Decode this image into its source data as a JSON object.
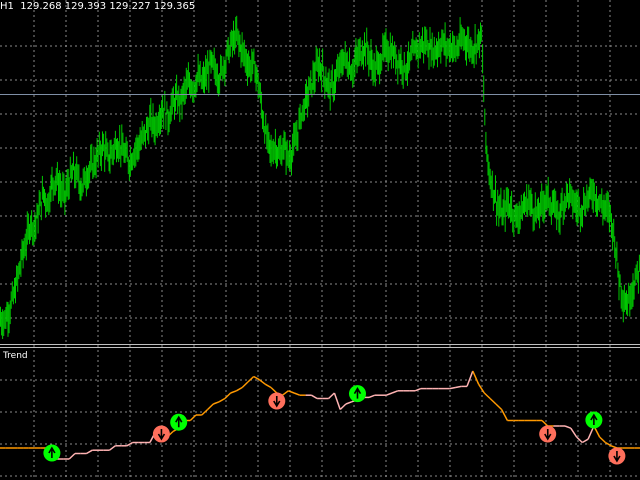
{
  "header": {
    "timeframe": "H1",
    "ohlc": "129.268 129.393 129.227 129.365"
  },
  "indicator": {
    "label": "Trend"
  },
  "colors": {
    "background": "#000000",
    "candle": "#00c800",
    "grid": "#8a8a8a",
    "price_line": "#7f8fa6",
    "separator": "#bfbfbf",
    "trend_up": "#ffb3b3",
    "trend_down": "#ff9900",
    "buy_arrow": "#00ff00",
    "sell_arrow": "#ff6f5c"
  },
  "chart_data": [
    {
      "type": "candlestick",
      "price_series_close": [
        0.05,
        0.08,
        0.12,
        0.18,
        0.25,
        0.3,
        0.36,
        0.34,
        0.4,
        0.45,
        0.42,
        0.48,
        0.5,
        0.46,
        0.44,
        0.49,
        0.52,
        0.5,
        0.47,
        0.51,
        0.53,
        0.55,
        0.58,
        0.6,
        0.56,
        0.58,
        0.61,
        0.6,
        0.57,
        0.55,
        0.58,
        0.6,
        0.62,
        0.65,
        0.68,
        0.66,
        0.7,
        0.72,
        0.69,
        0.73,
        0.75,
        0.74,
        0.78,
        0.8,
        0.79,
        0.82,
        0.8,
        0.83,
        0.86,
        0.84,
        0.82,
        0.86,
        0.9,
        0.93,
        0.95,
        0.91,
        0.88,
        0.85,
        0.86,
        0.8,
        0.7,
        0.62,
        0.58,
        0.6,
        0.57,
        0.6,
        0.56,
        0.59,
        0.63,
        0.7,
        0.74,
        0.78,
        0.82,
        0.86,
        0.84,
        0.8,
        0.78,
        0.81,
        0.85,
        0.88,
        0.86,
        0.84,
        0.88,
        0.9,
        0.92,
        0.88,
        0.84,
        0.86,
        0.89,
        0.91,
        0.9,
        0.88,
        0.87,
        0.85,
        0.86,
        0.89,
        0.91,
        0.92,
        0.93,
        0.91,
        0.9,
        0.92,
        0.93,
        0.91,
        0.92,
        0.9,
        0.93,
        0.94,
        0.92,
        0.91,
        0.93,
        0.95,
        0.6,
        0.5,
        0.45,
        0.4,
        0.38,
        0.42,
        0.4,
        0.37,
        0.39,
        0.41,
        0.43,
        0.4,
        0.38,
        0.41,
        0.44,
        0.42,
        0.4,
        0.38,
        0.42,
        0.45,
        0.43,
        0.41,
        0.4,
        0.42,
        0.44,
        0.46,
        0.43,
        0.41,
        0.4,
        0.38,
        0.3,
        0.18,
        0.12,
        0.1,
        0.15,
        0.18,
        0.22
      ]
    },
    {
      "type": "line",
      "title": "Trend",
      "trend_series": [
        0.2,
        0.2,
        0.2,
        0.2,
        0.2,
        0.2,
        0.2,
        0.2,
        0.2,
        0.1,
        0.1,
        0.1,
        0.1,
        0.15,
        0.15,
        0.15,
        0.18,
        0.18,
        0.18,
        0.18,
        0.22,
        0.22,
        0.22,
        0.25,
        0.25,
        0.25,
        0.25,
        0.35,
        0.4,
        0.3,
        0.35,
        0.38,
        0.45,
        0.45,
        0.5,
        0.5,
        0.55,
        0.6,
        0.62,
        0.65,
        0.7,
        0.72,
        0.75,
        0.8,
        0.85,
        0.82,
        0.78,
        0.75,
        0.7,
        0.68,
        0.72,
        0.7,
        0.68,
        0.68,
        0.68,
        0.65,
        0.65,
        0.65,
        0.7,
        0.55,
        0.6,
        0.62,
        0.64,
        0.66,
        0.66,
        0.68,
        0.68,
        0.68,
        0.7,
        0.72,
        0.72,
        0.72,
        0.72,
        0.74,
        0.74,
        0.74,
        0.74,
        0.74,
        0.74,
        0.75,
        0.76,
        0.76,
        0.9,
        0.78,
        0.7,
        0.65,
        0.6,
        0.55,
        0.45,
        0.45,
        0.45,
        0.45,
        0.45,
        0.45,
        0.45,
        0.4,
        0.4,
        0.4,
        0.4,
        0.38,
        0.3,
        0.25,
        0.28,
        0.4,
        0.3,
        0.25,
        0.22,
        0.2,
        0.2,
        0.2,
        0.2,
        0.2
      ],
      "arrows": [
        {
          "direction": "up",
          "index": 9
        },
        {
          "direction": "down",
          "index": 28
        },
        {
          "direction": "up",
          "index": 31
        },
        {
          "direction": "down",
          "index": 48
        },
        {
          "direction": "up",
          "index": 62
        },
        {
          "direction": "down",
          "index": 95
        },
        {
          "direction": "up",
          "index": 103
        },
        {
          "direction": "down",
          "index": 107
        }
      ]
    }
  ]
}
